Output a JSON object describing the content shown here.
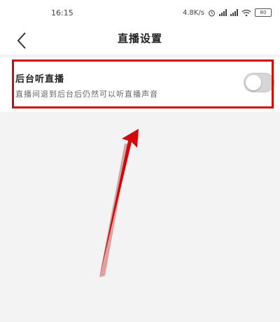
{
  "statusbar": {
    "time": "16:15",
    "net_speed": "4.8K/s",
    "battery": "80"
  },
  "header": {
    "title": "直播设置"
  },
  "setting": {
    "title": "后台听直播",
    "description": "直播间退到后台后仍然可以听直播声音",
    "enabled": false
  },
  "colors": {
    "highlight": "#d40a0a",
    "toggle_off": "#d6d6d6"
  },
  "icons": {
    "back": "chevron-left-icon",
    "alarm": "alarm-icon",
    "wifi": "wifi-icon"
  }
}
